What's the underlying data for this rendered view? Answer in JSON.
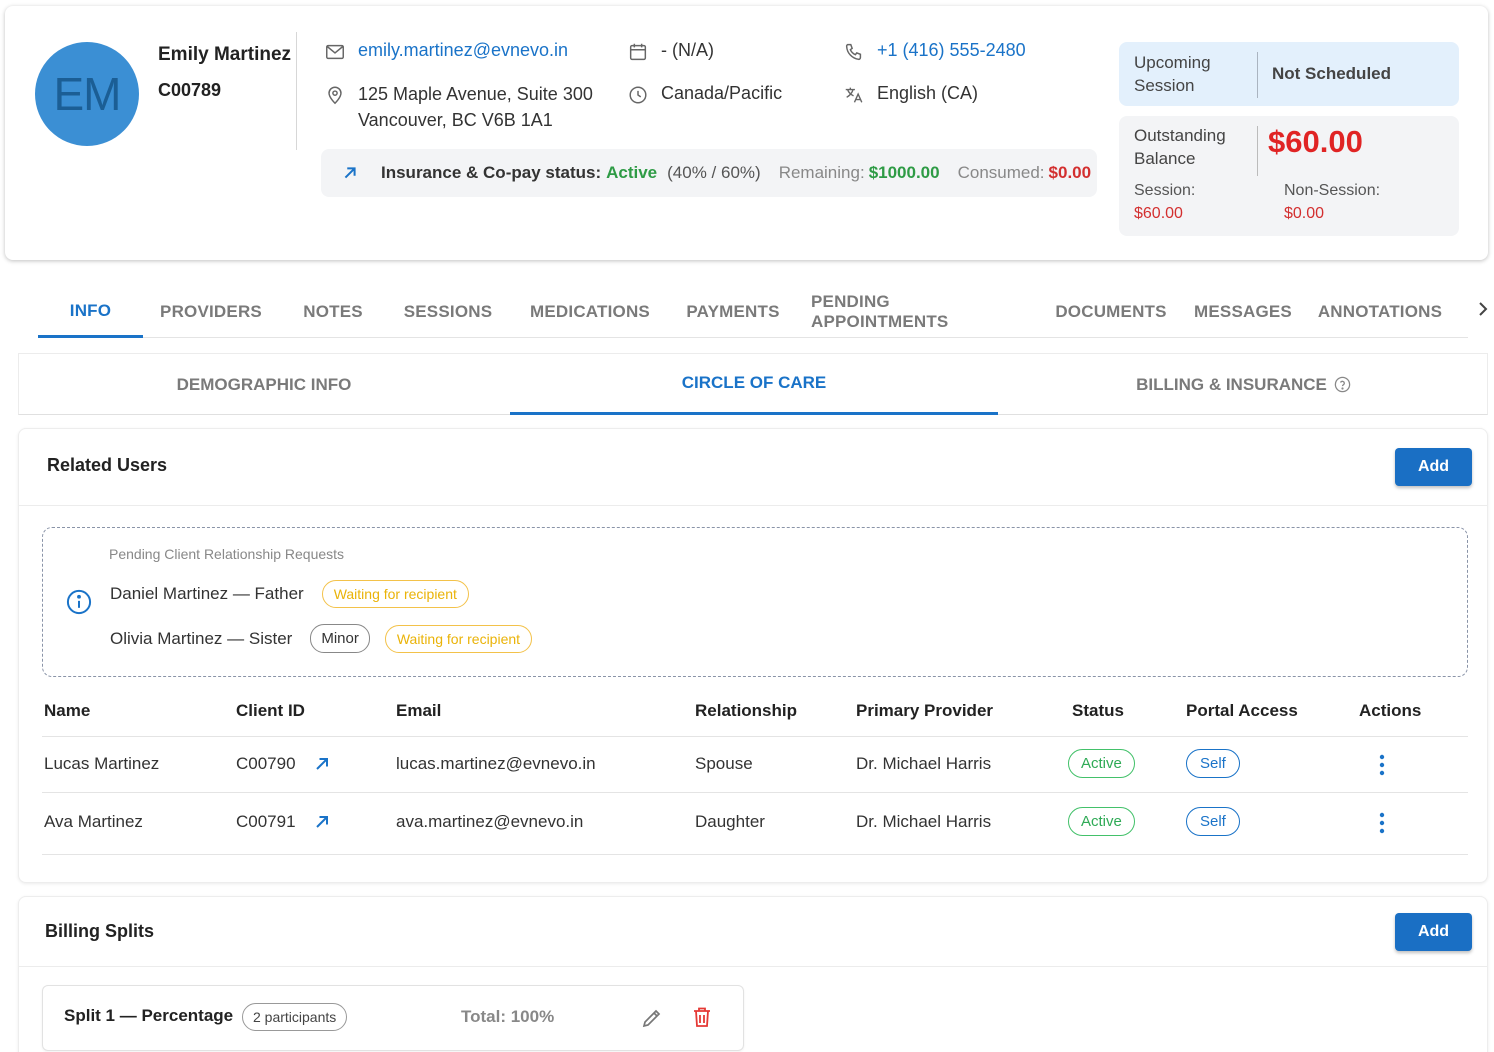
{
  "client": {
    "initials": "EM",
    "name": "Emily Martinez",
    "id": "C00789",
    "email": "emily.martinez@evnevo.in",
    "address_line1": "125 Maple Avenue, Suite 300",
    "address_line2": "Vancouver, BC V6B 1A1",
    "dob": "- (N/A)",
    "timezone": "Canada/Pacific",
    "phone": "+1 (416) 555-2480",
    "language": "English (CA)"
  },
  "insurance": {
    "label": "Insurance & Co-pay status:",
    "status": "Active",
    "split": "(40% / 60%)",
    "remaining_label": "Remaining:",
    "remaining_value": "$1000.00",
    "consumed_label": "Consumed:",
    "consumed_value": "$0.00"
  },
  "upcoming": {
    "label_line1": "Upcoming",
    "label_line2": "Session",
    "value": "Not Scheduled"
  },
  "balance": {
    "label_line1": "Outstanding",
    "label_line2": "Balance",
    "amount": "$60.00",
    "session_label": "Session:",
    "session_value": "$60.00",
    "non_session_label": "Non-Session:",
    "non_session_value": "$0.00"
  },
  "main_tabs": [
    "INFO",
    "PROVIDERS",
    "NOTES",
    "SESSIONS",
    "MEDICATIONS",
    "PAYMENTS",
    "PENDING APPOINTMENTS",
    "DOCUMENTS",
    "MESSAGES",
    "ANNOTATIONS"
  ],
  "sub_tabs": [
    "DEMOGRAPHIC INFO",
    "CIRCLE OF CARE",
    "BILLING & INSURANCE"
  ],
  "related_users": {
    "title": "Related Users",
    "add_label": "Add",
    "pending_title": "Pending Client Relationship Requests",
    "pending": [
      {
        "name": "Daniel Martinez — Father",
        "minor": "",
        "status": "Waiting for recipient"
      },
      {
        "name": "Olivia Martinez — Sister",
        "minor": "Minor",
        "status": "Waiting for recipient"
      }
    ],
    "columns": [
      "Name",
      "Client ID",
      "Email",
      "Relationship",
      "Primary Provider",
      "Status",
      "Portal Access",
      "Actions"
    ],
    "rows": [
      {
        "name": "Lucas Martinez",
        "client_id": "C00790",
        "email": "lucas.martinez@evnevo.in",
        "relationship": "Spouse",
        "provider": "Dr. Michael Harris",
        "status": "Active",
        "portal": "Self"
      },
      {
        "name": "Ava Martinez",
        "client_id": "C00791",
        "email": "ava.martinez@evnevo.in",
        "relationship": "Daughter",
        "provider": "Dr. Michael Harris",
        "status": "Active",
        "portal": "Self"
      }
    ]
  },
  "billing_splits": {
    "title": "Billing Splits",
    "add_label": "Add",
    "splits": [
      {
        "title": "Split 1 — Percentage",
        "participants": "2 participants",
        "total": "Total: 100%"
      }
    ]
  },
  "colors": {
    "accent": "#1a73c8",
    "avatar_bg": "#3b8fd4",
    "active_green": "#2e9b45",
    "balance_red": "#e02424",
    "waiting_yellow": "#eab308"
  },
  "icons": [
    "mail-icon",
    "location-icon",
    "calendar-icon",
    "clock-icon",
    "phone-icon",
    "translate-icon",
    "arrow-up-right-icon",
    "chevron-right-icon",
    "help-circle-icon",
    "info-circle-icon",
    "kebab-icon",
    "pencil-icon",
    "trash-icon"
  ]
}
